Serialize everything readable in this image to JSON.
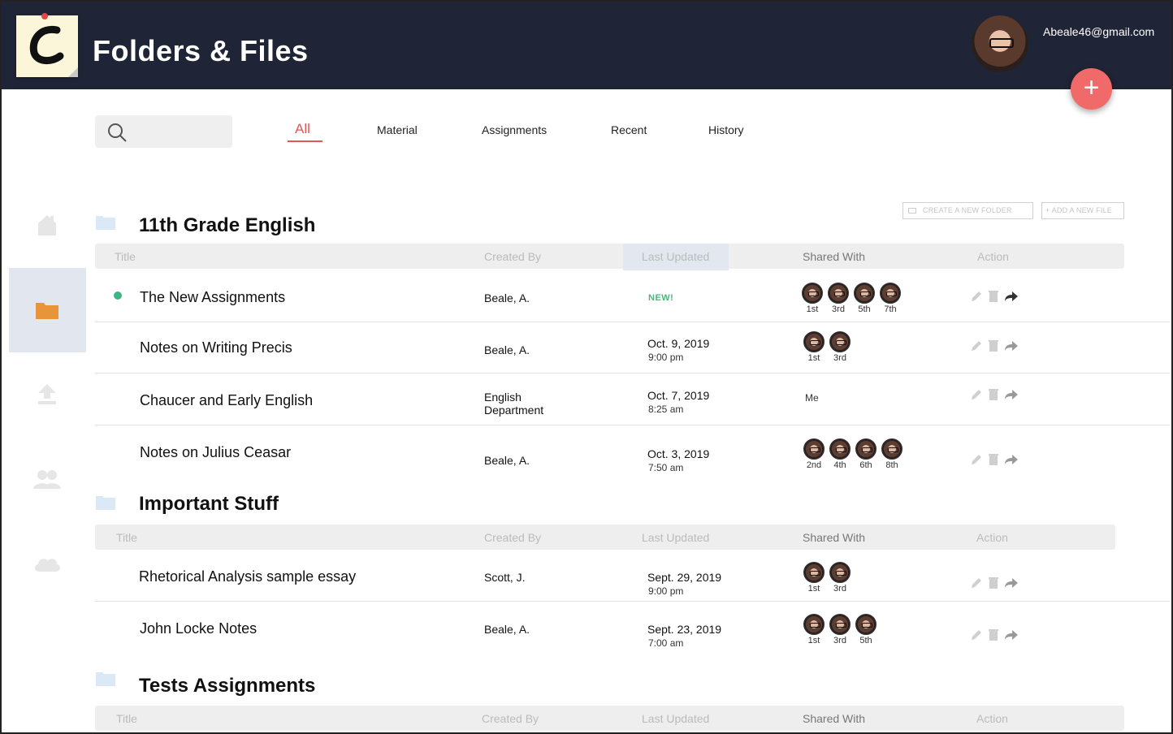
{
  "app": {
    "title": "Folders & Files",
    "user_email": "Abeale46@gmail.com",
    "fab_label": "+"
  },
  "search": {
    "placeholder": ""
  },
  "tabs": [
    {
      "label": "All",
      "active": true
    },
    {
      "label": "Material"
    },
    {
      "label": "Assignments"
    },
    {
      "label": "Recent"
    },
    {
      "label": "History"
    }
  ],
  "sidebar": [
    {
      "icon": "home-icon"
    },
    {
      "icon": "folder-icon",
      "active": true
    },
    {
      "icon": "upload-icon"
    },
    {
      "icon": "users-icon"
    },
    {
      "icon": "cloud-icon"
    }
  ],
  "toolbar": {
    "create_folder": "CREATE A NEW FOLDER",
    "add_file": "ADD A NEW FILE"
  },
  "columns": {
    "title": "Title",
    "created_by": "Created By",
    "last_updated": "Last Updated",
    "shared_with": "Shared With",
    "action": "Action"
  },
  "sections": [
    {
      "title": "11th Grade English",
      "rows": [
        {
          "title": "The New Assignments",
          "created_by": "Beale, A.",
          "date": "",
          "time": "",
          "badge": "NEW!",
          "indicator": true,
          "shared": [
            "1st",
            "3rd",
            "5th",
            "7th"
          ]
        },
        {
          "title": "Notes on Writing Precis",
          "created_by": "Beale, A.",
          "date": "Oct. 9, 2019",
          "time": "9:00 pm",
          "shared": [
            "1st",
            "3rd"
          ]
        },
        {
          "title": "Chaucer and Early English",
          "created_by_line1": "English",
          "created_by_line2": "Department",
          "date": "Oct. 7, 2019",
          "time": "8:25 am",
          "shared_text": "Me"
        },
        {
          "title": "Notes on Julius Ceasar",
          "created_by": "Beale, A.",
          "date": "Oct. 3, 2019",
          "time": "7:50 am",
          "shared": [
            "2nd",
            "4th",
            "6th",
            "8th"
          ]
        }
      ]
    },
    {
      "title": "Important Stuff",
      "rows": [
        {
          "title": "Rhetorical Analysis sample essay",
          "created_by": "Scott, J.",
          "date": "Sept. 29, 2019",
          "time": "9:00 pm",
          "shared": [
            "1st",
            "3rd"
          ]
        },
        {
          "title": "John Locke Notes",
          "created_by": "Beale, A.",
          "date": "Sept. 23, 2019",
          "time": "7:00 am",
          "shared": [
            "1st",
            "3rd",
            "5th"
          ]
        }
      ]
    },
    {
      "title": "Tests Assignments",
      "rows": []
    }
  ],
  "colors": {
    "header_bg": "#1f2536",
    "accent": "#e45656",
    "fab": "#f06a6a",
    "new_badge": "#4fb57d",
    "sidebar_active": "#e1e6ef"
  }
}
